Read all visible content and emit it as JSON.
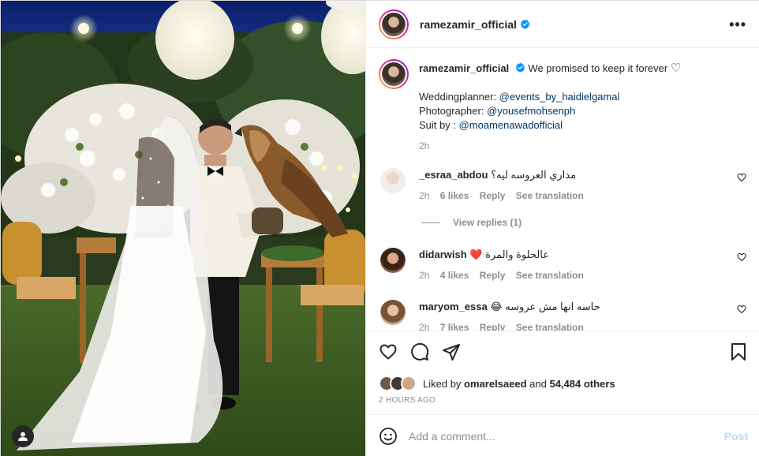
{
  "post": {
    "username": "ramezamir_official",
    "verified": true,
    "more_label": "•••"
  },
  "caption": {
    "username": "ramezamir_official",
    "text": "We promised to keep it forever",
    "heart_emoji": "♡",
    "line1_label": "Weddingplanner: ",
    "line1_link": "@events_by_haidielgamal",
    "line2_label": "Photographer: ",
    "line2_link": "@yousefmohsenph",
    "line3_label": "Suit by : ",
    "line3_link": "@moamenawadofficial",
    "time": "2h"
  },
  "comments": [
    {
      "username": "_esraa_abdou",
      "text": "مداري العروسه ليه؟",
      "time": "2h",
      "likes": "6 likes",
      "reply": "Reply",
      "translate": "See translation",
      "view_replies": "View replies (1)"
    },
    {
      "username": "didarwish",
      "emoji": "❤️",
      "text": "عالحلوة والمرة",
      "time": "2h",
      "likes": "4 likes",
      "reply": "Reply",
      "translate": "See translation"
    },
    {
      "username": "maryom_essa",
      "emoji": "😂",
      "text": "حاسه انها مش عروسه",
      "time": "2h",
      "likes": "7 likes",
      "reply": "Reply",
      "translate": "See translation"
    }
  ],
  "likes": {
    "prefix": "Liked by ",
    "user": "omarelsaeed",
    "and": " and ",
    "others": "54,484 others"
  },
  "timestamp": "2 HOURS AGO",
  "add_comment": {
    "placeholder": "Add a comment...",
    "post_label": "Post"
  },
  "colors": {
    "verified": "#0095f6",
    "link": "#00376b",
    "muted": "#8e8e8e",
    "post_disabled": "#b2dffc"
  }
}
